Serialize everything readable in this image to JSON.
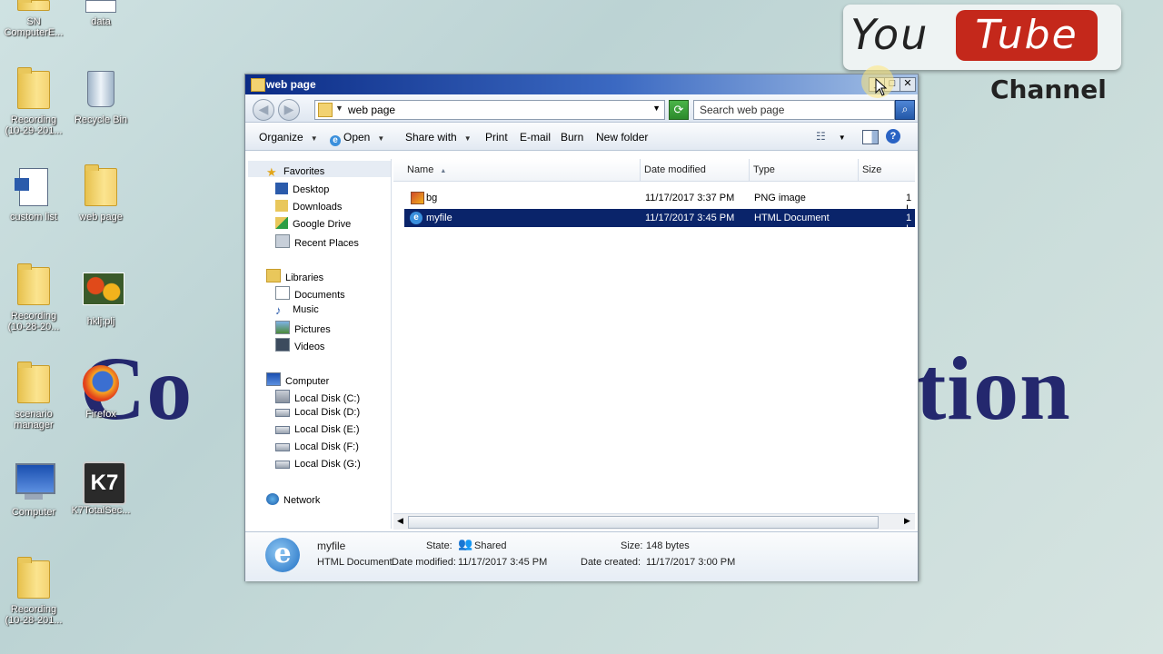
{
  "desktop": {
    "icons": [
      {
        "label": "SN\nComputerE..."
      },
      {
        "label": "data"
      },
      {
        "label": "Recording\n(10-29-201..."
      },
      {
        "label": "Recycle Bin"
      },
      {
        "label": "custom list"
      },
      {
        "label": "web page"
      },
      {
        "label": "Recording\n(10-28-20..."
      },
      {
        "label": "hklj;plj"
      },
      {
        "label": "scenario\nmanager"
      },
      {
        "label": "Firefox"
      },
      {
        "label": "Computer"
      },
      {
        "label": "K7TotalSec..."
      },
      {
        "label": "Recording\n(10-28-201..."
      }
    ],
    "background_text_left": "Co",
    "background_text_right": "tion"
  },
  "youtube": {
    "you": "You",
    "tube": "Tube",
    "channel": "Channel"
  },
  "window": {
    "title": "web page",
    "address": "web page",
    "search_placeholder": "Search web page",
    "commands": [
      "Organize",
      "Open",
      "Share with",
      "Print",
      "E-mail",
      "Burn",
      "New folder"
    ],
    "nav": {
      "favorites": "Favorites",
      "favorites_items": [
        "Desktop",
        "Downloads",
        "Google Drive",
        "Recent Places"
      ],
      "libraries": "Libraries",
      "libraries_items": [
        "Documents",
        "Music",
        "Pictures",
        "Videos"
      ],
      "computer": "Computer",
      "computer_items": [
        "Local Disk (C:)",
        "Local Disk (D:)",
        "Local Disk (E:)",
        "Local Disk (F:)",
        "Local Disk (G:)"
      ],
      "network": "Network"
    },
    "columns": [
      "Name",
      "Date modified",
      "Type",
      "Size"
    ],
    "files": [
      {
        "name": "bg",
        "date": "11/17/2017 3:37 PM",
        "type": "PNG image",
        "size": "1 I"
      },
      {
        "name": "myfile",
        "date": "11/17/2017 3:45 PM",
        "type": "HTML Document",
        "size": "1 I"
      }
    ],
    "details": {
      "name": "myfile",
      "type_label": "HTML Document",
      "state_label": "State:",
      "state_value": "Shared",
      "size_label": "Size:",
      "size_value": "148 bytes",
      "modified_label": "Date modified:",
      "modified_value": "11/17/2017 3:45 PM",
      "created_label": "Date created:",
      "created_value": "11/17/2017 3:00 PM"
    }
  },
  "colors": {
    "selection": "#0a246a",
    "title_start": "#0b2b85",
    "accent_red": "#c4281b",
    "brand_text": "#24286e"
  }
}
